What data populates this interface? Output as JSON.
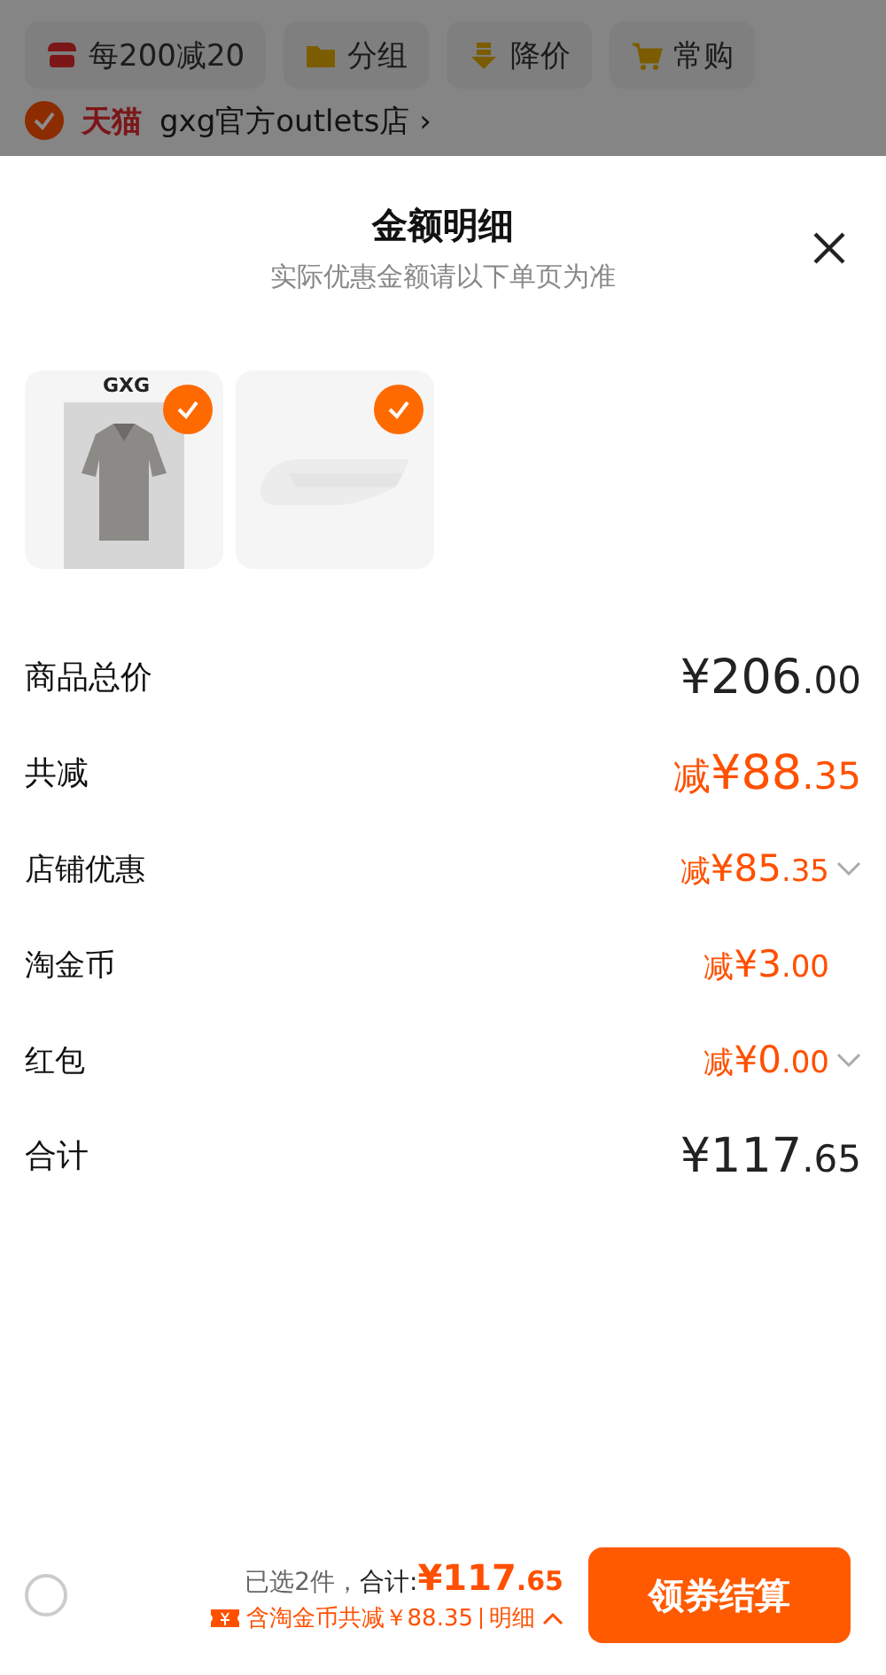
{
  "toolbar": [
    {
      "label": "每200减20"
    },
    {
      "label": "分组"
    },
    {
      "label": "降价"
    },
    {
      "label": "常购"
    }
  ],
  "shop": {
    "checked": true,
    "brand": "天猫",
    "name": "gxg官方outlets店 ›"
  },
  "sheet": {
    "title": "金额明细",
    "subtitle": "实际优惠金额请以下单页为准",
    "products": [
      {
        "kind": "shirt",
        "brand": "GXG",
        "checked": true
      },
      {
        "kind": "socks",
        "checked": true
      }
    ],
    "rows": [
      {
        "label": "商品总价",
        "prefix": "",
        "amount": "¥206",
        "cents": ".00",
        "kind": "total",
        "expandable": false
      },
      {
        "label": "共减",
        "prefix": "减",
        "amount": "¥88",
        "cents": ".35",
        "kind": "discount-big",
        "expandable": false
      },
      {
        "label": "店铺优惠",
        "prefix": "减",
        "amount": "¥85",
        "cents": ".35",
        "kind": "discount",
        "expandable": true
      },
      {
        "label": "淘金币",
        "prefix": "减",
        "amount": "¥3",
        "cents": ".00",
        "kind": "discount",
        "expandable": false
      },
      {
        "label": "红包",
        "prefix": "减",
        "amount": "¥0",
        "cents": ".00",
        "kind": "discount",
        "expandable": true
      },
      {
        "label": "合计",
        "prefix": "",
        "amount": "¥117",
        "cents": ".65",
        "kind": "total",
        "expandable": false
      }
    ]
  },
  "footer": {
    "select_all": false,
    "selected_text": "已选2件，",
    "total_label": "合计:",
    "total_amount": "¥117",
    "total_cents": ".65",
    "saving": "含淘金币共减￥88.35",
    "detail": "明细",
    "checkout": "领券结算"
  }
}
